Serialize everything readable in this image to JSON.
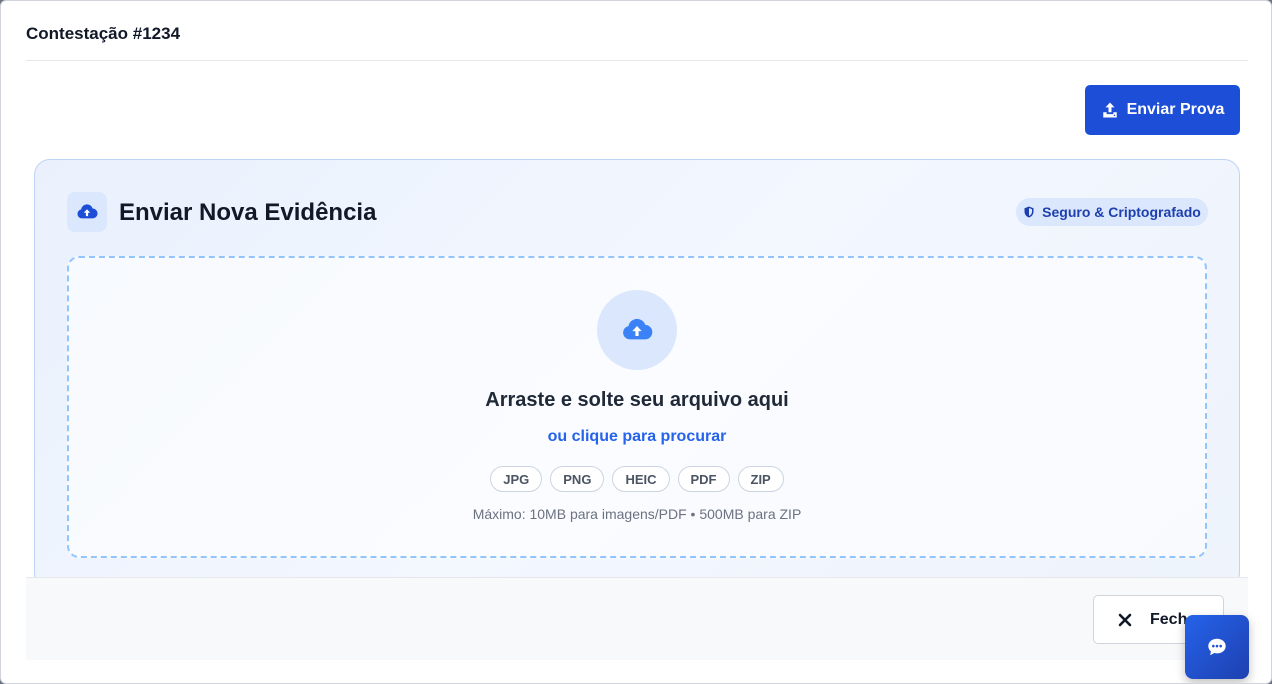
{
  "header": {
    "title": "Contestação #1234"
  },
  "toolbar": {
    "send_proof_label": "Enviar Prova"
  },
  "upload_card": {
    "title": "Enviar Nova Evidência",
    "badge": "Seguro & Criptografado",
    "dropzone": {
      "title": "Arraste e solte seu arquivo aqui",
      "link": "ou clique para procurar",
      "formats": [
        "JPG",
        "PNG",
        "HEIC",
        "PDF",
        "ZIP"
      ],
      "limits": "Máximo: 10MB para imagens/PDF • 500MB para ZIP"
    }
  },
  "footer": {
    "close_label": "Fechar"
  },
  "icons": {
    "upload": "upload-icon",
    "cloud_upload": "cloud-upload-icon",
    "shield": "shield-icon",
    "close": "close-icon",
    "chat": "chat-icon"
  },
  "colors": {
    "primary": "#1d4ed8",
    "link": "#2563eb",
    "badge_text": "#1e40af",
    "card_border": "#bfd3f5",
    "dropzone_border": "#93c5fd"
  }
}
